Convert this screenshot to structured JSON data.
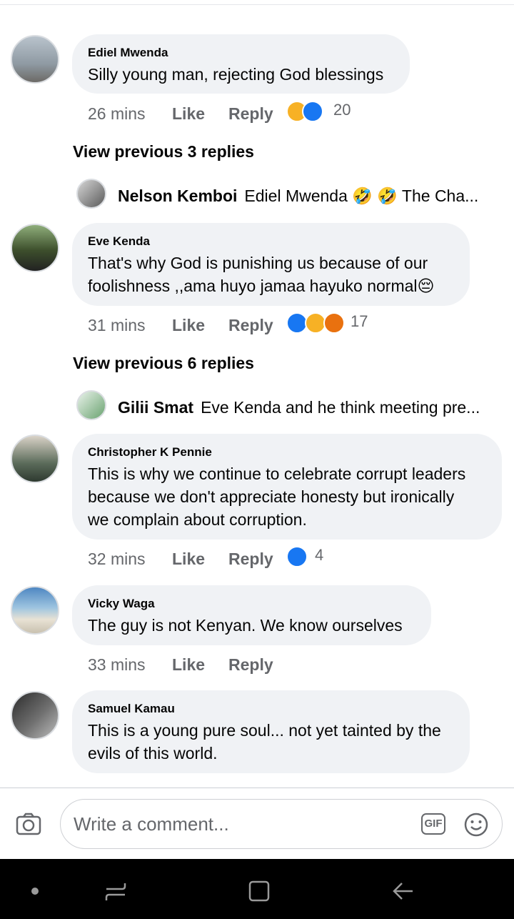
{
  "comments": [
    {
      "name": "Ediel Mwenda",
      "lines": [
        "Silly young man, rejecting God blessings"
      ],
      "time": "26 mins",
      "like": "Like",
      "reply": "Reply",
      "reactions": [
        "haha",
        "like"
      ],
      "count": "20"
    },
    {
      "name": "Eve Kenda",
      "lines": [
        "That's why God is punishing us because of our",
        "foolishness ,,ama huyo jamaa hayuko normal😔"
      ],
      "time": "31 mins",
      "like": "Like",
      "reply": "Reply",
      "reactions": [
        "like",
        "haha",
        "angry"
      ],
      "count": "17"
    },
    {
      "name": "Christopher K Pennie",
      "lines": [
        "This is why we continue to celebrate corrupt leaders",
        "because we don't appreciate honesty but ironically",
        "we complain about corruption."
      ],
      "time": "32 mins",
      "like": "Like",
      "reply": "Reply",
      "reactions": [
        "like"
      ],
      "count": "4"
    },
    {
      "name": "Vicky Waga",
      "lines": [
        "The guy is not Kenyan. We know ourselves"
      ],
      "time": "33 mins",
      "like": "Like",
      "reply": "Reply",
      "reactions": [],
      "count": ""
    },
    {
      "name": "Samuel Kamau",
      "lines": [
        "This is a young pure soul... not yet tainted by the",
        "evils of this world."
      ],
      "time": "",
      "like": "",
      "reply": "",
      "reactions": [],
      "count": ""
    }
  ],
  "view_previous": [
    "View previous 3 replies",
    "View previous 6 replies"
  ],
  "replies": [
    {
      "name": "Nelson Kemboi",
      "text": "Ediel Mwenda 🤣 🤣 The Cha..."
    },
    {
      "name": "Gilii Smat",
      "text": "Eve Kenda and he think meeting pre..."
    }
  ],
  "composer": {
    "placeholder": "Write a comment...",
    "gif_label": "GIF"
  },
  "colors": {
    "accent": "#1877f2",
    "bubble": "#f0f2f5",
    "meta": "#65676b"
  },
  "icons": [
    "camera-icon",
    "gif-icon",
    "emoji-icon",
    "nav-dot-icon",
    "recent-apps-icon",
    "home-icon",
    "back-icon"
  ]
}
